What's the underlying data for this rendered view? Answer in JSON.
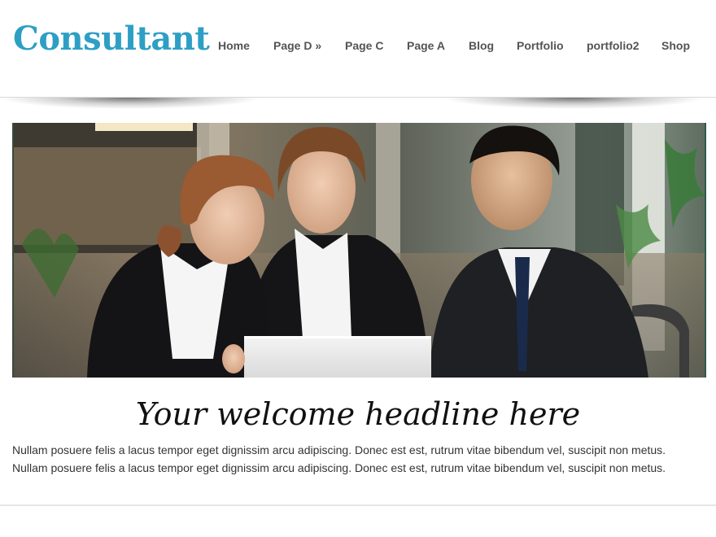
{
  "site": {
    "logo": "Consultant"
  },
  "nav": {
    "items": [
      {
        "label": "Home"
      },
      {
        "label": "Page D »"
      },
      {
        "label": "Page C"
      },
      {
        "label": "Page A"
      },
      {
        "label": "Blog"
      },
      {
        "label": "Portfolio"
      },
      {
        "label": "portfolio2"
      },
      {
        "label": "Shop"
      }
    ]
  },
  "hero": {
    "image": "business-team-at-laptop-photo"
  },
  "welcome": {
    "headline": "Your welcome headline here",
    "body": "Nullam posuere felis a lacus tempor eget dignissim arcu adipiscing. Donec est est, rutrum vitae bibendum vel, suscipit non metus. Nullam posuere felis a lacus tempor eget dignissim arcu adipiscing. Donec est est, rutrum vitae bibendum vel, suscipit non metus."
  },
  "colors": {
    "logo": "#2e9fc4",
    "nav_text": "#545454",
    "body_text": "#333333",
    "headline_text": "#111111"
  }
}
